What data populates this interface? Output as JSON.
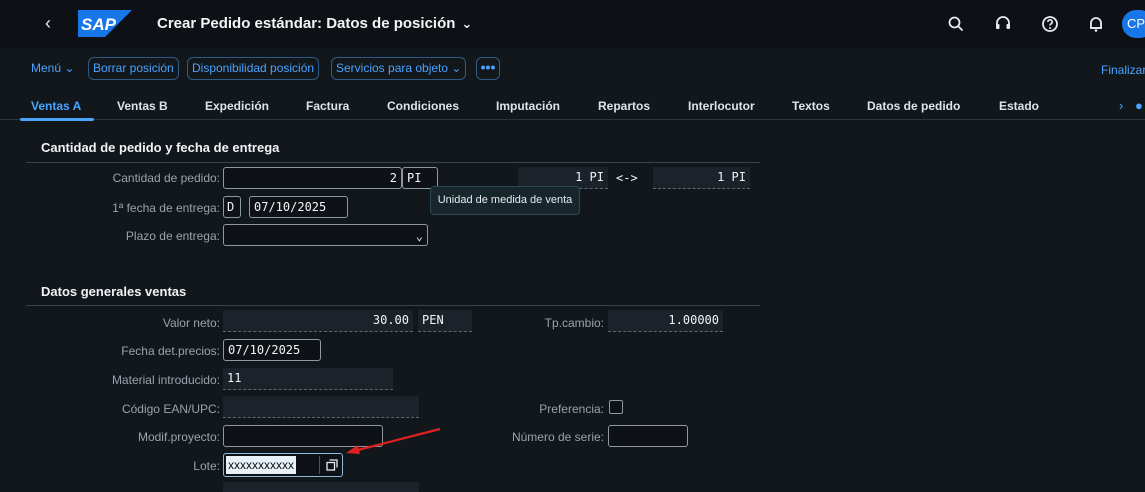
{
  "shell": {
    "logo_text": "SAP",
    "title": "Crear Pedido estándar: Datos de posición",
    "avatar_initials": "CP",
    "brand_color": "#1877e8"
  },
  "toolbar": {
    "menu_label": "Menú",
    "buttons": [
      "Borrar posición",
      "Disponibilidad posición",
      "Servicios para objeto"
    ],
    "more_label": "•••",
    "finish_label": "Finalizar"
  },
  "tabs": [
    "Ventas A",
    "Ventas B",
    "Expedición",
    "Factura",
    "Condiciones",
    "Imputación",
    "Repartos",
    "Interlocutor",
    "Textos",
    "Datos de pedido",
    "Estado"
  ],
  "section1": {
    "title": "Cantidad de pedido y fecha de entrega",
    "order_qty_label": "Cantidad de pedido:",
    "order_qty_value": "2",
    "order_qty_unit": "PI",
    "conv_qty_left": "1 PI",
    "conv_arrow": "<->",
    "conv_qty_right": "1 PI",
    "tooltip": "Unidad de medida de venta",
    "first_delivery_label": "1ª fecha de entrega:",
    "date_type": "D",
    "first_delivery_value": "07/10/2025",
    "delivery_term_label": "Plazo de entrega:",
    "delivery_term_value": ""
  },
  "section2": {
    "title": "Datos generales ventas",
    "net_value_label": "Valor neto:",
    "net_value": "30.00",
    "currency": "PEN",
    "exchange_label": "Tp.cambio:",
    "exchange_value": "1.00000",
    "price_date_label": "Fecha det.precios:",
    "price_date_value": "07/10/2025",
    "material_label": "Material introducido:",
    "material_value": "11",
    "ean_label": "Código EAN/UPC:",
    "ean_value": "",
    "preference_label": "Preferencia:",
    "project_label": "Modif.proyecto:",
    "project_value": "",
    "serial_label": "Número de serie:",
    "serial_value": "",
    "lote_label": "Lote:",
    "lote_value": "xxxxxxxxxxx"
  }
}
